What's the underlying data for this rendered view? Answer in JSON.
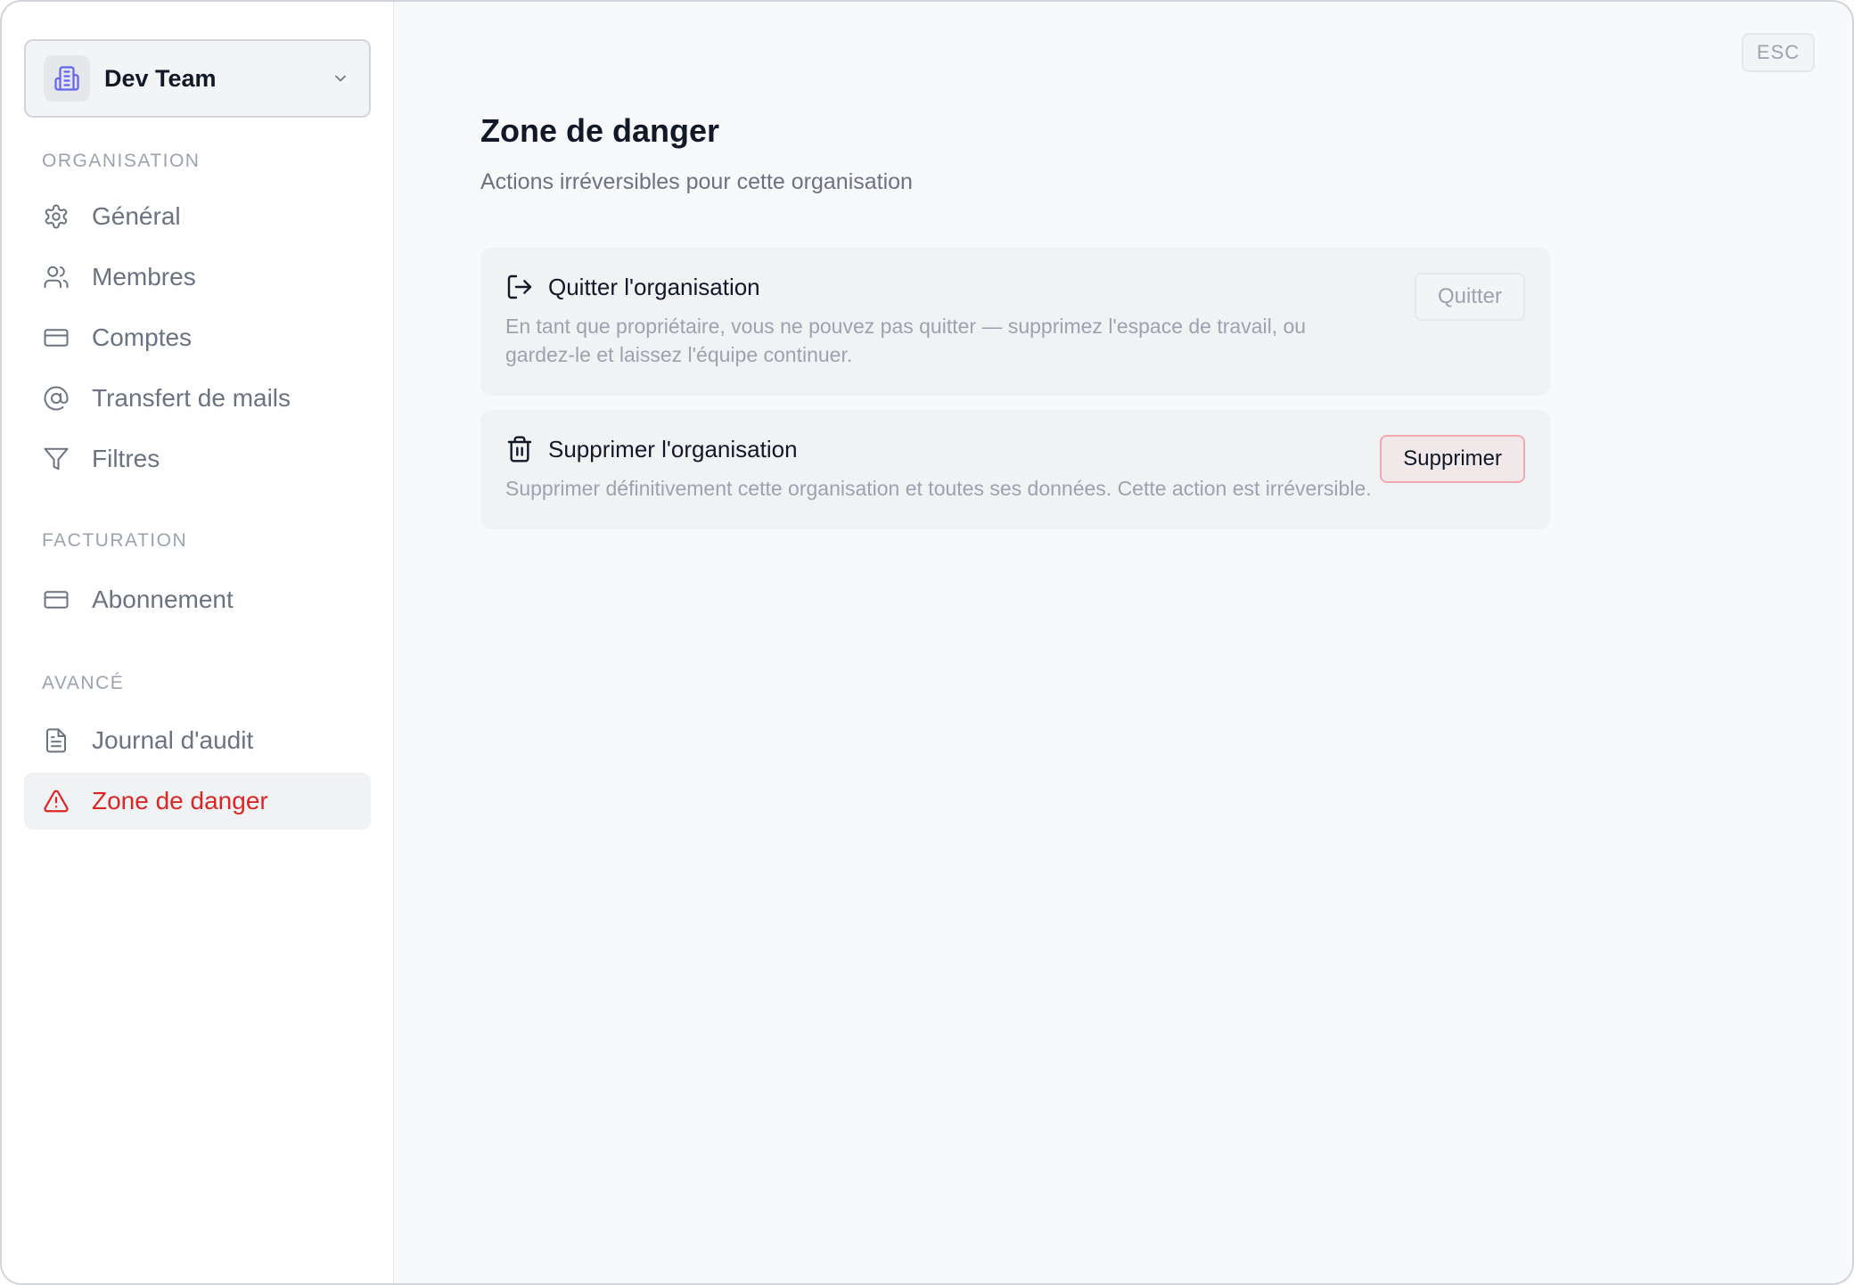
{
  "org": {
    "name": "Dev Team"
  },
  "sidebar": {
    "sections": [
      {
        "label": "ORGANISATION",
        "items": [
          {
            "label": "Général",
            "icon": "gear-icon"
          },
          {
            "label": "Membres",
            "icon": "users-icon"
          },
          {
            "label": "Comptes",
            "icon": "credit-card-icon"
          },
          {
            "label": "Transfert de mails",
            "icon": "at-sign-icon"
          },
          {
            "label": "Filtres",
            "icon": "filter-icon"
          }
        ]
      },
      {
        "label": "FACTURATION",
        "items": [
          {
            "label": "Abonnement",
            "icon": "credit-card-icon"
          }
        ]
      },
      {
        "label": "AVANCÉ",
        "items": [
          {
            "label": "Journal d'audit",
            "icon": "file-text-icon"
          },
          {
            "label": "Zone de danger",
            "icon": "alert-triangle-icon",
            "active": true
          }
        ]
      }
    ]
  },
  "header": {
    "esc_label": "ESC"
  },
  "main": {
    "title": "Zone de danger",
    "subtitle": "Actions irréversibles pour cette organisation",
    "cards": [
      {
        "title": "Quitter l'organisation",
        "description": "En tant que propriétaire, vous ne pouvez pas quitter — supprimez l'espace de travail, ou gardez-le et laissez l'équipe continuer.",
        "button": "Quitter",
        "icon": "log-out-icon"
      },
      {
        "title": "Supprimer l'organisation",
        "description": "Supprimer définitivement cette organisation et toutes ses données. Cette action est irréversible.",
        "button": "Supprimer",
        "icon": "trash-icon"
      }
    ]
  },
  "colors": {
    "accent": "#6366f1",
    "danger": "#dc2626",
    "muted": "#9ca3af"
  }
}
